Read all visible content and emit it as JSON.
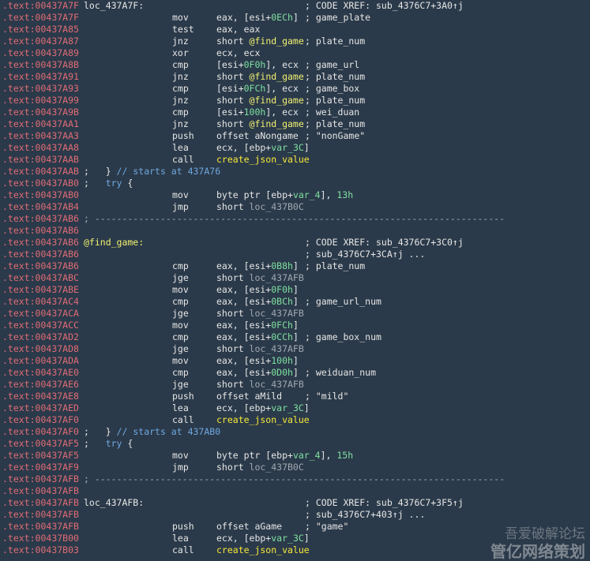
{
  "theme": {
    "background": "#2b3a4a",
    "segment": "#e06c75",
    "text": "#e6e6e6",
    "comment": "#a0a8b0",
    "number": "#7ee0a0",
    "label": "#f0f070",
    "function": "#f7e839"
  },
  "lines": [
    {
      "a": ".text:00437A7F",
      "l": "loc_437A7F:",
      "c": "; CODE XREF: sub_4376C7+3A0↑j"
    },
    {
      "a": ".text:00437A7F",
      "m": "mov",
      "o": "eax, [esi+0ECh]",
      "c": "; game_plate"
    },
    {
      "a": ".text:00437A85",
      "m": "test",
      "o": "eax, eax"
    },
    {
      "a": ".text:00437A87",
      "m": "jnz",
      "o": "short @find_game",
      "c": "; plate_num"
    },
    {
      "a": ".text:00437A89",
      "m": "xor",
      "o": "ecx, ecx"
    },
    {
      "a": ".text:00437A8B",
      "m": "cmp",
      "o": "[esi+0F0h], ecx",
      "c": "; game_url"
    },
    {
      "a": ".text:00437A91",
      "m": "jnz",
      "o": "short @find_game",
      "c": "; plate_num"
    },
    {
      "a": ".text:00437A93",
      "m": "cmp",
      "o": "[esi+0FCh], ecx",
      "c": "; game_box"
    },
    {
      "a": ".text:00437A99",
      "m": "jnz",
      "o": "short @find_game",
      "c": "; plate_num"
    },
    {
      "a": ".text:00437A9B",
      "m": "cmp",
      "o": "[esi+100h], ecx",
      "c": "; wei_duan"
    },
    {
      "a": ".text:00437AA1",
      "m": "jnz",
      "o": "short @find_game",
      "c": "; plate_num"
    },
    {
      "a": ".text:00437AA3",
      "m": "push",
      "o": "offset aNongame",
      "c": "; \"nonGame\""
    },
    {
      "a": ".text:00437AA8",
      "m": "lea",
      "o": "ecx, [ebp+var_3C]"
    },
    {
      "a": ".text:00437AAB",
      "m": "call",
      "o": "create_json_value"
    },
    {
      "a": ".text:00437AAB",
      "f": ";   } // starts at 437A76"
    },
    {
      "a": ".text:00437AB0",
      "f": ";   try {"
    },
    {
      "a": ".text:00437AB0",
      "m": "mov",
      "o": "byte ptr [ebp+var_4], 13h"
    },
    {
      "a": ".text:00437AB4",
      "m": "jmp",
      "o": "short loc_437B0C"
    },
    {
      "a": ".text:00437AB6",
      "f": "; ---------------------------------------------------------------------------"
    },
    {
      "a": ".text:00437AB6"
    },
    {
      "a": ".text:00437AB6",
      "l": "@find_game:",
      "c": "; CODE XREF: sub_4376C7+3C0↑j"
    },
    {
      "a": ".text:00437AB6",
      "c": "; sub_4376C7+3CA↑j ..."
    },
    {
      "a": ".text:00437AB6",
      "m": "cmp",
      "o": "eax, [esi+0B8h]",
      "c": "; plate_num"
    },
    {
      "a": ".text:00437ABC",
      "m": "jge",
      "o": "short loc_437AFB"
    },
    {
      "a": ".text:00437ABE",
      "m": "mov",
      "o": "eax, [esi+0F0h]"
    },
    {
      "a": ".text:00437AC4",
      "m": "cmp",
      "o": "eax, [esi+0BCh]",
      "c": "; game_url_num"
    },
    {
      "a": ".text:00437ACA",
      "m": "jge",
      "o": "short loc_437AFB"
    },
    {
      "a": ".text:00437ACC",
      "m": "mov",
      "o": "eax, [esi+0FCh]"
    },
    {
      "a": ".text:00437AD2",
      "m": "cmp",
      "o": "eax, [esi+0CCh]",
      "c": "; game_box_num"
    },
    {
      "a": ".text:00437AD8",
      "m": "jge",
      "o": "short loc_437AFB"
    },
    {
      "a": ".text:00437ADA",
      "m": "mov",
      "o": "eax, [esi+100h]"
    },
    {
      "a": ".text:00437AE0",
      "m": "cmp",
      "o": "eax, [esi+0D0h]",
      "c": "; weiduan_num"
    },
    {
      "a": ".text:00437AE6",
      "m": "jge",
      "o": "short loc_437AFB"
    },
    {
      "a": ".text:00437AE8",
      "m": "push",
      "o": "offset aMild",
      "c": "; \"mild\""
    },
    {
      "a": ".text:00437AED",
      "m": "lea",
      "o": "ecx, [ebp+var_3C]"
    },
    {
      "a": ".text:00437AF0",
      "m": "call",
      "o": "create_json_value"
    },
    {
      "a": ".text:00437AF0",
      "f": ";   } // starts at 437AB0"
    },
    {
      "a": ".text:00437AF5",
      "f": ";   try {"
    },
    {
      "a": ".text:00437AF5",
      "m": "mov",
      "o": "byte ptr [ebp+var_4], 15h"
    },
    {
      "a": ".text:00437AF9",
      "m": "jmp",
      "o": "short loc_437B0C"
    },
    {
      "a": ".text:00437AFB",
      "f": "; ---------------------------------------------------------------------------"
    },
    {
      "a": ".text:00437AFB"
    },
    {
      "a": ".text:00437AFB",
      "l": "loc_437AFB:",
      "c": "; CODE XREF: sub_4376C7+3F5↑j"
    },
    {
      "a": ".text:00437AFB",
      "c": "; sub_4376C7+403↑j ..."
    },
    {
      "a": ".text:00437AFB",
      "m": "push",
      "o": "offset aGame",
      "c": "; \"game\""
    },
    {
      "a": ".text:00437B00",
      "m": "lea",
      "o": "ecx, [ebp+var_3C]"
    },
    {
      "a": ".text:00437B03",
      "m": "call",
      "o": "create_json_value"
    }
  ],
  "watermark": {
    "line1": "吾爱破解论坛",
    "line2": "管亿网络策划"
  }
}
